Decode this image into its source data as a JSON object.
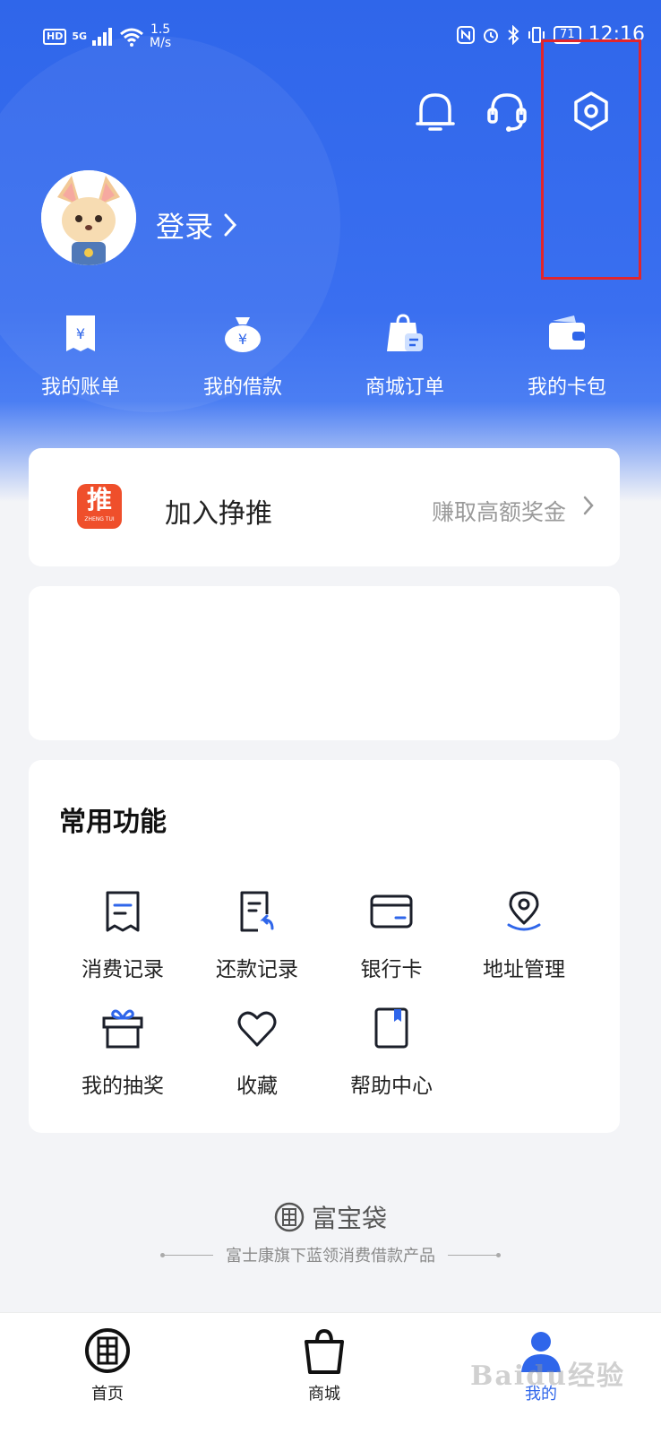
{
  "status_bar": {
    "hd": "HD",
    "network": "5G",
    "speed_value": "1.5",
    "speed_unit": "M/s",
    "battery": "71",
    "time": "12:16"
  },
  "header": {
    "icons": [
      "bell-icon",
      "headset-icon",
      "settings-hexagon-icon"
    ]
  },
  "profile": {
    "login_label": "登录"
  },
  "quick_actions": [
    {
      "label": "我的账单",
      "icon": "bill-icon"
    },
    {
      "label": "我的借款",
      "icon": "money-bag-icon"
    },
    {
      "label": "商城订单",
      "icon": "order-bag-icon"
    },
    {
      "label": "我的卡包",
      "icon": "wallet-icon"
    }
  ],
  "promo": {
    "logo_text": "推",
    "logo_sub": "ZHENG TUI",
    "title": "加入挣推",
    "subtitle": "赚取高额奖金"
  },
  "common_functions": {
    "title": "常用功能",
    "items": [
      {
        "label": "消费记录",
        "icon": "receipt-icon"
      },
      {
        "label": "还款记录",
        "icon": "repayment-record-icon"
      },
      {
        "label": "银行卡",
        "icon": "bank-card-icon"
      },
      {
        "label": "地址管理",
        "icon": "location-pin-icon"
      },
      {
        "label": "我的抽奖",
        "icon": "gift-icon"
      },
      {
        "label": "收藏",
        "icon": "heart-icon"
      },
      {
        "label": "帮助中心",
        "icon": "help-book-icon"
      }
    ]
  },
  "brand": {
    "name": "富宝袋",
    "tagline": "富士康旗下蓝领消费借款产品"
  },
  "tabbar": {
    "tabs": [
      {
        "label": "首页",
        "icon": "home-logo-icon"
      },
      {
        "label": "商城",
        "icon": "shopping-bag-icon"
      },
      {
        "label": "我的",
        "icon": "user-icon"
      }
    ],
    "active": "我的"
  },
  "watermark": "Baidu经验",
  "colors": {
    "primary": "#2f66ea",
    "highlight": "#e2252b",
    "promo_logo": "#ef4f2b"
  }
}
